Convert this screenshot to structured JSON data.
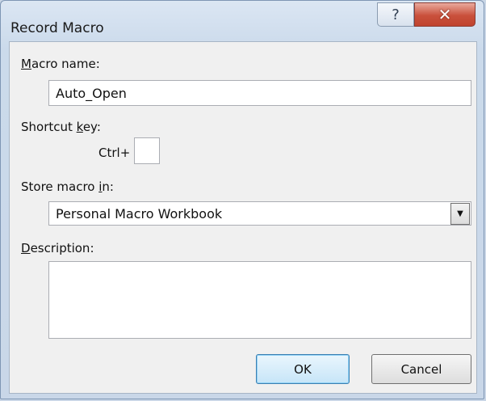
{
  "window": {
    "title": "Record Macro",
    "help_glyph": "?",
    "close_glyph": "✕"
  },
  "form": {
    "macro_name": {
      "label_first": "M",
      "label_rest": "acro name:",
      "value": "Auto_Open"
    },
    "shortcut": {
      "label_start": "Shortcut ",
      "label_mnemonic": "k",
      "label_end": "ey:",
      "prefix": "Ctrl+",
      "value": ""
    },
    "store": {
      "label_start": "Store macro ",
      "label_mnemonic": "i",
      "label_end": "n:",
      "selected": "Personal Macro Workbook",
      "arrow": "▼"
    },
    "description": {
      "label_first": "D",
      "label_rest": "escription:",
      "value": ""
    }
  },
  "buttons": {
    "ok": "OK",
    "cancel": "Cancel"
  },
  "icons": {
    "help": "help-icon",
    "close": "close-icon",
    "dropdown": "chevron-down-icon"
  }
}
